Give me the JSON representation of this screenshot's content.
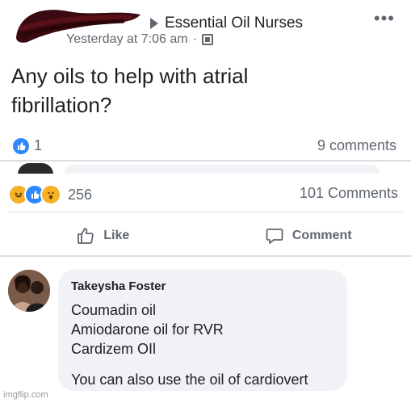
{
  "shared_post": {
    "group_name": "Essential Oil Nurses",
    "timestamp": "Yesterday at 7:06 am",
    "more_label": "•••",
    "text_line1": "Any oils to help with atrial",
    "text_line2": "fibrillation?",
    "like_count": "1",
    "comments": "9 comments"
  },
  "stats": {
    "reactions": [
      "haha",
      "like",
      "wow"
    ],
    "reaction_count": "256",
    "comments": "101 Comments"
  },
  "actions": {
    "like_label": "Like",
    "comment_label": "Comment"
  },
  "comment": {
    "author": "Takeysha Foster",
    "lines": [
      "Coumadin oil",
      "Amiodarone oil for RVR",
      "Cardizem OIl"
    ],
    "last_line": "You can also use the oil of cardiovert"
  },
  "watermark": "imgflip.com",
  "colors": {
    "like_blue": "#2d88ff",
    "reaction_yellow": "#f7b125",
    "secondary_text": "#606770",
    "bubble_bg": "#f0f2f5"
  }
}
